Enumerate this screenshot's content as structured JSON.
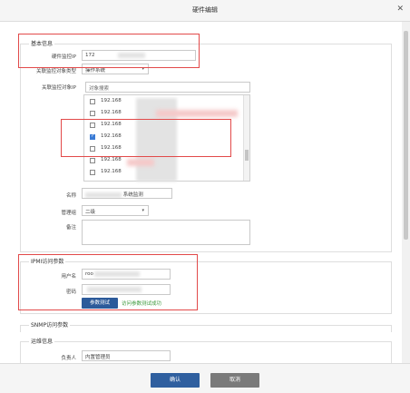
{
  "dialog": {
    "title": "硬件编辑",
    "close_icon": "close-icon"
  },
  "basic": {
    "legend": "基本信息",
    "ip_label": "硬件监控IP",
    "ip_value": "172",
    "object_type_label": "关联监控对象类型",
    "object_type_value": "操作系统",
    "related_ip_label": "关联监控对象IP",
    "search_placeholder": "对象搜索",
    "list": [
      {
        "ip": "192.168",
        "checked": false
      },
      {
        "ip": "192.168",
        "checked": false
      },
      {
        "ip": "192.168",
        "checked": false
      },
      {
        "ip": "192.168",
        "checked": true
      },
      {
        "ip": "192.168",
        "checked": false
      },
      {
        "ip": "192.168",
        "checked": false
      },
      {
        "ip": "192.168",
        "checked": false
      }
    ],
    "name_label": "名称",
    "name_suffix": "系统监测",
    "group_label": "管理组",
    "group_value": "二级",
    "remark_label": "备注"
  },
  "ipmi": {
    "legend": "IPMI访问参数",
    "user_label": "用户名",
    "user_value": "roo",
    "password_label": "密码",
    "password_value": "",
    "test_button": "参数测试",
    "test_result": "访问参数测试成功"
  },
  "snmp": {
    "legend": "SNMP访问参数"
  },
  "ops": {
    "legend": "运维信息",
    "owner_label": "负责人",
    "owner_value": "内置管理员"
  },
  "footer": {
    "ok_label": "确认",
    "cancel_label": "取消"
  },
  "colors": {
    "primary": "#2f5f9f",
    "cancel": "#7a7a7a",
    "highlight": "#e24a4a",
    "success": "#3c9a3c"
  }
}
